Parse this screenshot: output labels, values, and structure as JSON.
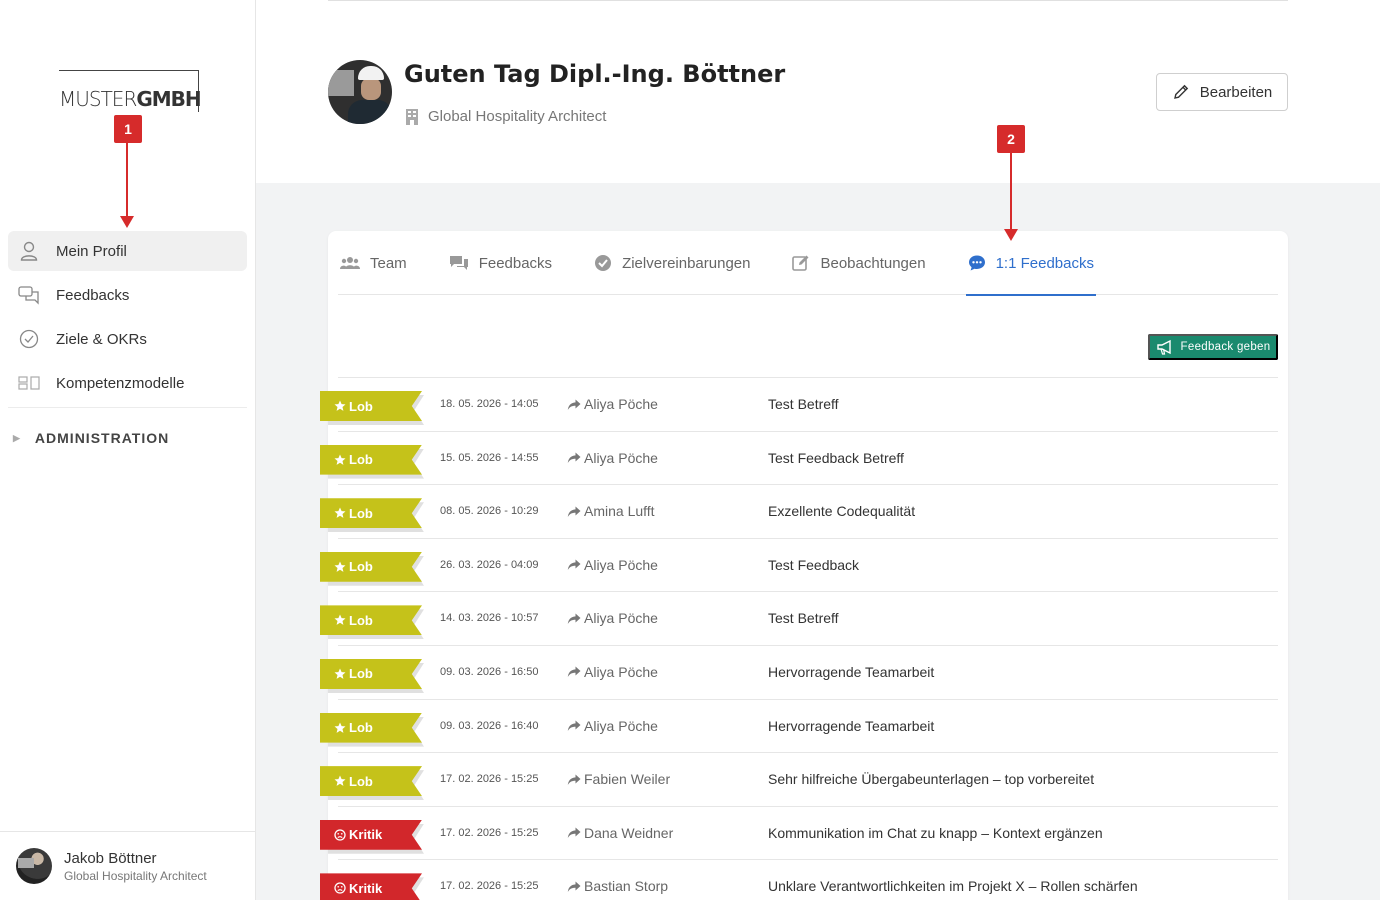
{
  "sidebar": {
    "logo": {
      "part1": "MUSTER",
      "part2": "GMBH"
    },
    "nav": [
      {
        "label": "Mein Profil",
        "icon": "user-icon",
        "active": true
      },
      {
        "label": "Feedbacks",
        "icon": "chat-bubbles-icon",
        "active": false
      },
      {
        "label": "Ziele & OKRs",
        "icon": "check-circle-icon",
        "active": false
      },
      {
        "label": "Kompetenzmodelle",
        "icon": "blocks-icon",
        "active": false
      }
    ],
    "admin_label": "ADMINISTRATION",
    "user": {
      "name": "Jakob Böttner",
      "role": "Global Hospitality Architect"
    }
  },
  "markers": {
    "m1": "1",
    "m2": "2"
  },
  "header": {
    "greeting": "Guten Tag Dipl.-Ing. Böttner",
    "job_title": "Global Hospitality Architect",
    "edit_label": "Bearbeiten"
  },
  "tabs": [
    {
      "label": "Team",
      "icon": "users-icon",
      "active": false
    },
    {
      "label": "Feedbacks",
      "icon": "comments-icon",
      "active": false
    },
    {
      "label": "Zielvereinbarungen",
      "icon": "check-circle-icon",
      "active": false
    },
    {
      "label": "Beobachtungen",
      "icon": "edit-icon",
      "active": false
    },
    {
      "label": "1:1 Feedbacks",
      "icon": "comment-dots-icon",
      "active": true
    }
  ],
  "feedback_button": "Feedback geben",
  "colors": {
    "lob": "#c5c21a",
    "kritik": "#d2272b",
    "accent": "#2f6fcc",
    "button": "#1a8a6e"
  },
  "rows": [
    {
      "type": "Lob",
      "date": "18. 05. 2026 - 14:05",
      "from": "Aliya Pöche",
      "subject": "Test Betreff"
    },
    {
      "type": "Lob",
      "date": "15. 05. 2026 - 14:55",
      "from": "Aliya Pöche",
      "subject": "Test Feedback Betreff"
    },
    {
      "type": "Lob",
      "date": "08. 05. 2026 - 10:29",
      "from": "Amina Lufft",
      "subject": "Exzellente Codequalität"
    },
    {
      "type": "Lob",
      "date": "26. 03. 2026 - 04:09",
      "from": "Aliya Pöche",
      "subject": "Test Feedback"
    },
    {
      "type": "Lob",
      "date": "14. 03. 2026 - 10:57",
      "from": "Aliya Pöche",
      "subject": "Test Betreff"
    },
    {
      "type": "Lob",
      "date": "09. 03. 2026 - 16:50",
      "from": "Aliya Pöche",
      "subject": "Hervorragende Teamarbeit"
    },
    {
      "type": "Lob",
      "date": "09. 03. 2026 - 16:40",
      "from": "Aliya Pöche",
      "subject": "Hervorragende Teamarbeit"
    },
    {
      "type": "Lob",
      "date": "17. 02. 2026 - 15:25",
      "from": "Fabien Weiler",
      "subject": "Sehr hilfreiche Übergabeunterlagen – top vorbereitet"
    },
    {
      "type": "Kritik",
      "date": "17. 02. 2026 - 15:25",
      "from": "Dana Weidner",
      "subject": "Kommunikation im Chat zu knapp – Kontext ergänzen"
    },
    {
      "type": "Kritik",
      "date": "17. 02. 2026 - 15:25",
      "from": "Bastian Storp",
      "subject": "Unklare Verantwortlichkeiten im Projekt X – Rollen schärfen"
    }
  ]
}
